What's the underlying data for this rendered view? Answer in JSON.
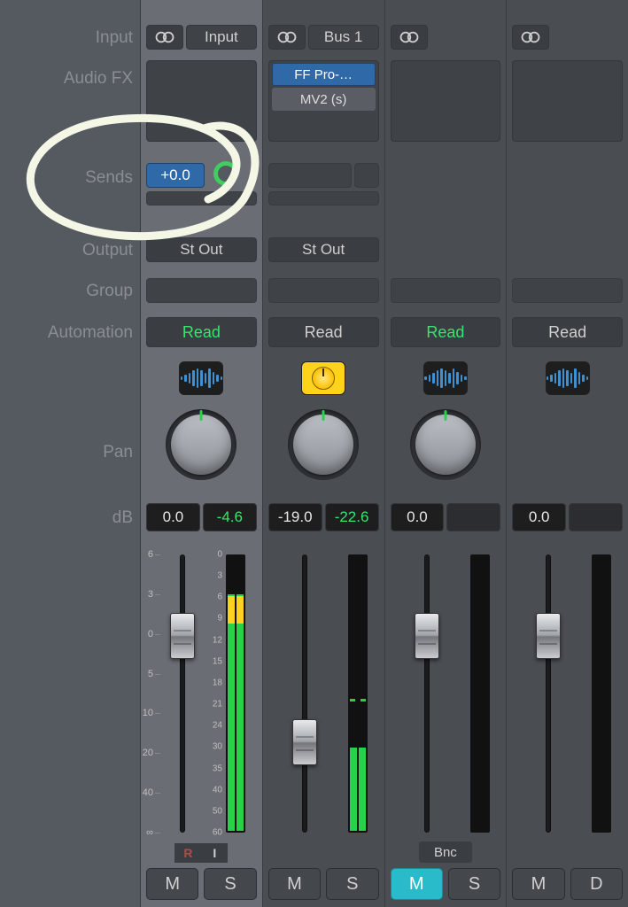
{
  "rowLabels": {
    "input": "Input",
    "audioFX": "Audio FX",
    "sends": "Sends",
    "output": "Output",
    "group": "Group",
    "automation": "Automation",
    "pan": "Pan",
    "dB": "dB"
  },
  "strips": [
    {
      "input": "Input",
      "stereo": true,
      "fx": [],
      "send": {
        "value": "+0.0",
        "active": true
      },
      "output": "St Out",
      "automation": {
        "label": "Read",
        "green": true
      },
      "modeIcon": "waveform",
      "pan": "center",
      "db": {
        "fader": "0.0",
        "meter": "-4.6",
        "meterEmpty": false
      },
      "faderPos": 0.3,
      "meter": {
        "level": 0.85,
        "yellow": 0.1,
        "dash": false
      },
      "rec": {
        "R": "R",
        "I": "I"
      },
      "bottom": {
        "left": "M",
        "right": "S",
        "muteOn": false
      }
    },
    {
      "input": "Bus 1",
      "stereo": true,
      "fx": [
        {
          "label": "FF Pro-…",
          "active": true
        },
        {
          "label": "MV2 (s)",
          "active": false
        }
      ],
      "send": null,
      "output": "St Out",
      "automation": {
        "label": "Read",
        "green": false
      },
      "modeIcon": "dial",
      "pan": "center",
      "db": {
        "fader": "-19.0",
        "meter": "-22.6",
        "meterEmpty": false
      },
      "faderPos": 0.7,
      "meter": {
        "level": 0.3,
        "yellow": 0,
        "dash": true
      },
      "bottom": {
        "left": "M",
        "right": "S",
        "muteOn": false
      }
    },
    {
      "input": "",
      "stereo": true,
      "fx": [],
      "send": null,
      "output": "",
      "automation": {
        "label": "Read",
        "green": true
      },
      "modeIcon": "waveform",
      "pan": "center",
      "db": {
        "fader": "0.0",
        "meter": "",
        "meterEmpty": true
      },
      "faderPos": 0.3,
      "meter": {
        "level": 0,
        "yellow": 0,
        "dash": false
      },
      "bnc": "Bnc",
      "bottom": {
        "left": "M",
        "right": "S",
        "muteOn": true
      }
    },
    {
      "input": "",
      "stereo": false,
      "fx": [],
      "send": null,
      "output": "",
      "automation": {
        "label": "Read",
        "green": false
      },
      "modeIcon": "waveform",
      "pan": "none",
      "db": {
        "fader": "0.0",
        "meter": "",
        "meterEmpty": true
      },
      "faderPos": 0.3,
      "meter": {
        "level": 0,
        "yellow": 0,
        "dash": false
      },
      "bottom": {
        "left": "M",
        "right": "D",
        "muteOn": false
      }
    }
  ],
  "faderScale": {
    "left": [
      "6",
      "3",
      "0",
      "5",
      "10",
      "20",
      "40",
      "∞"
    ],
    "right": [
      "0",
      "3",
      "6",
      "9",
      "12",
      "15",
      "18",
      "21",
      "24",
      "30",
      "35",
      "40",
      "50",
      "60"
    ]
  }
}
